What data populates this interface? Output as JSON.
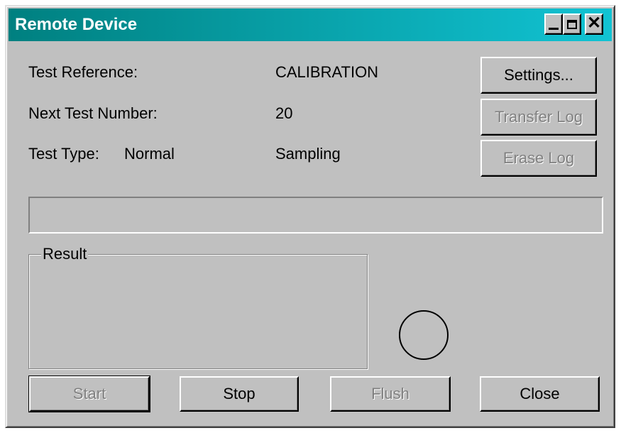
{
  "window": {
    "title": "Remote Device"
  },
  "fields": {
    "test_reference_label": "Test Reference:",
    "test_reference_value": "CALIBRATION",
    "next_test_number_label": "Next Test Number:",
    "next_test_number_value": "20",
    "test_type_label": "Test Type:",
    "test_type_value": "Normal",
    "mode_value": "Sampling"
  },
  "side_buttons": {
    "settings": "Settings...",
    "transfer_log": "Transfer Log",
    "erase_log": "Erase Log"
  },
  "progress": {
    "fraction": 0
  },
  "result_group": {
    "label": "Result"
  },
  "bottom_buttons": {
    "start": "Start",
    "stop": "Stop",
    "flush": "Flush",
    "close": "Close"
  },
  "icons": {
    "minimize": "minimize-icon",
    "maximize": "maximize-icon",
    "close": "close-icon",
    "indicator": "status-indicator-circle"
  }
}
